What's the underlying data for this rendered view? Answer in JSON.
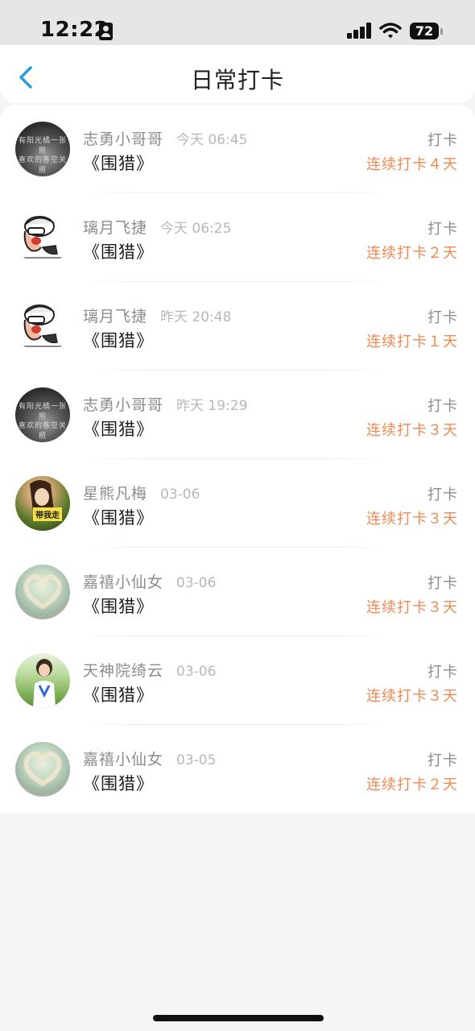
{
  "status": {
    "time": "12:22",
    "battery": "72"
  },
  "header": {
    "title": "日常打卡"
  },
  "list": [
    {
      "name": "志勇小哥哥",
      "time": "今天 06:45",
      "book": "《围猎》",
      "action": "打卡",
      "streak": "连续打卡４天",
      "avatar": "dark",
      "avatar_text": [
        "有阳光橘一张照",
        "喜欢的各空关照"
      ]
    },
    {
      "name": "璃月飞捷",
      "time": "今天 06:25",
      "book": "《围猎》",
      "action": "打卡",
      "streak": "连续打卡２天",
      "avatar": "cartoon"
    },
    {
      "name": "璃月飞捷",
      "time": "昨天 20:48",
      "book": "《围猎》",
      "action": "打卡",
      "streak": "连续打卡１天",
      "avatar": "cartoon"
    },
    {
      "name": "志勇小哥哥",
      "time": "昨天 19:29",
      "book": "《围猎》",
      "action": "打卡",
      "streak": "连续打卡３天",
      "avatar": "dark",
      "avatar_text": [
        "有阳光橘一张照",
        "喜欢的各空关照"
      ]
    },
    {
      "name": "星熊凡梅",
      "time": "03-06",
      "book": "《围猎》",
      "action": "打卡",
      "streak": "连续打卡３天",
      "avatar": "woman",
      "avatar_tag": "带我走"
    },
    {
      "name": "嘉禧小仙女",
      "time": "03-06",
      "book": "《围猎》",
      "action": "打卡",
      "streak": "连续打卡３天",
      "avatar": "heart"
    },
    {
      "name": "天神院绮云",
      "time": "03-06",
      "book": "《围猎》",
      "action": "打卡",
      "streak": "连续打卡３天",
      "avatar": "girl"
    },
    {
      "name": "嘉禧小仙女",
      "time": "03-05",
      "book": "《围猎》",
      "action": "打卡",
      "streak": "连续打卡２天",
      "avatar": "heart"
    }
  ],
  "colors": {
    "accent": "#ee8a52",
    "back_icon": "#2c9be0",
    "name_text": "#8c8c8c",
    "time_text": "#b8b8b8"
  },
  "icons": {
    "back": "chevron-left-icon",
    "signal": "cellular-signal-icon",
    "wifi": "wifi-icon",
    "battery": "battery-icon",
    "id": "id-card-icon"
  }
}
